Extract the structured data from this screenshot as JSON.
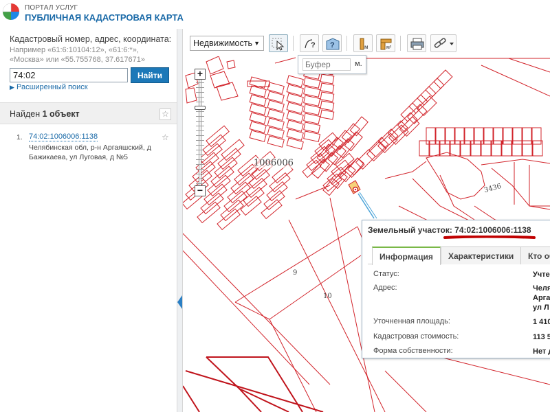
{
  "header": {
    "portal_name": "ПОРТАЛ УСЛУГ",
    "map_title": "ПУБЛИЧНАЯ КАДАСТРОВАЯ КАРТА"
  },
  "sidebar": {
    "search_hint": "Кадастровый номер, адрес, координата:",
    "search_example": "Например «61:6:10104:12», «61:6:*», «Москва» или «55.755768, 37.617671»",
    "search_value": "74:02",
    "search_button": "Найти",
    "advanced_search": "Расширенный поиск",
    "results_prefix": "Найден ",
    "results_count": "1 объект",
    "results": [
      {
        "num": "1.",
        "cadastral_number": "74:02:1006006:1138",
        "address": "Челябинская обл, р-н Аргаяшский, д Бажикаева, ул Луговая, д №5"
      }
    ]
  },
  "toolbar": {
    "layer_select": "Недвижимость",
    "buffer_placeholder": "Буфер",
    "buffer_unit": "м."
  },
  "map": {
    "quarter_label": "1006006",
    "road_label": "3436",
    "plot_labels": [
      "9",
      "10"
    ]
  },
  "info_popup": {
    "title_prefix": "Земельный участок: ",
    "title_number": "74:02:1006006:1138",
    "tabs": [
      "Информация",
      "Характеристики",
      "Кто об"
    ],
    "fields": [
      {
        "label": "Статус:",
        "value": "Учте"
      },
      {
        "label": "Адрес:",
        "value": "Челя\nАрга\nул Л"
      },
      {
        "label": "Уточненная площадь:",
        "value": "1 410"
      },
      {
        "label": "Кадастровая стоимость:",
        "value": "113 5"
      },
      {
        "label": "Форма собственности:",
        "value": "Нет д"
      }
    ]
  },
  "colors": {
    "accent_blue": "#1c78b8",
    "parcel_red": "#d2232a",
    "tab_green": "#7ab847"
  },
  "icons": [
    "logo-icon",
    "select-cursor-icon",
    "identify-icon",
    "info-icon",
    "measure-icon",
    "measure-area-icon",
    "print-icon",
    "link-icon",
    "star-icon"
  ]
}
